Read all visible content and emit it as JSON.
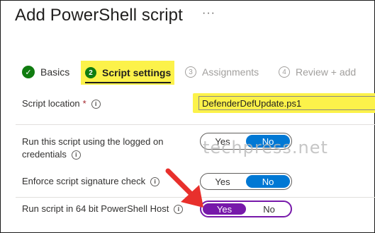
{
  "header": {
    "title": "Add PowerShell script",
    "more": "···"
  },
  "steps": [
    {
      "number": "✓",
      "label": "Basics",
      "state": "complete"
    },
    {
      "number": "2",
      "label": "Script settings",
      "state": "current"
    },
    {
      "number": "3",
      "label": "Assignments",
      "state": "upcoming"
    },
    {
      "number": "4",
      "label": "Review + add",
      "state": "upcoming"
    }
  ],
  "fields": {
    "script_location": {
      "label": "Script location",
      "required_mark": "*",
      "value": "DefenderDefUpdate.ps1"
    },
    "run_logged_on": {
      "label_line1": "Run this script using the logged on",
      "label_line2": "credentials",
      "yes": "Yes",
      "no": "No",
      "selected": "No"
    },
    "signature_check": {
      "label": "Enforce script signature check",
      "yes": "Yes",
      "no": "No",
      "selected": "No"
    },
    "run_64bit": {
      "label": "Run script in 64 bit PowerShell Host",
      "yes": "Yes",
      "no": "No",
      "selected": "Yes"
    }
  },
  "info_glyph": "i",
  "watermark": "techpress.net",
  "colors": {
    "highlight": "#fcf24a",
    "complete_green": "#107c10",
    "toggle_blue": "#0078d4",
    "toggle_purple": "#7719aa",
    "arrow_red": "#e8302c"
  },
  "icons": {
    "step_done": "checkmark-circle-icon",
    "info": "info-icon",
    "annotation": "red-arrow-icon"
  }
}
